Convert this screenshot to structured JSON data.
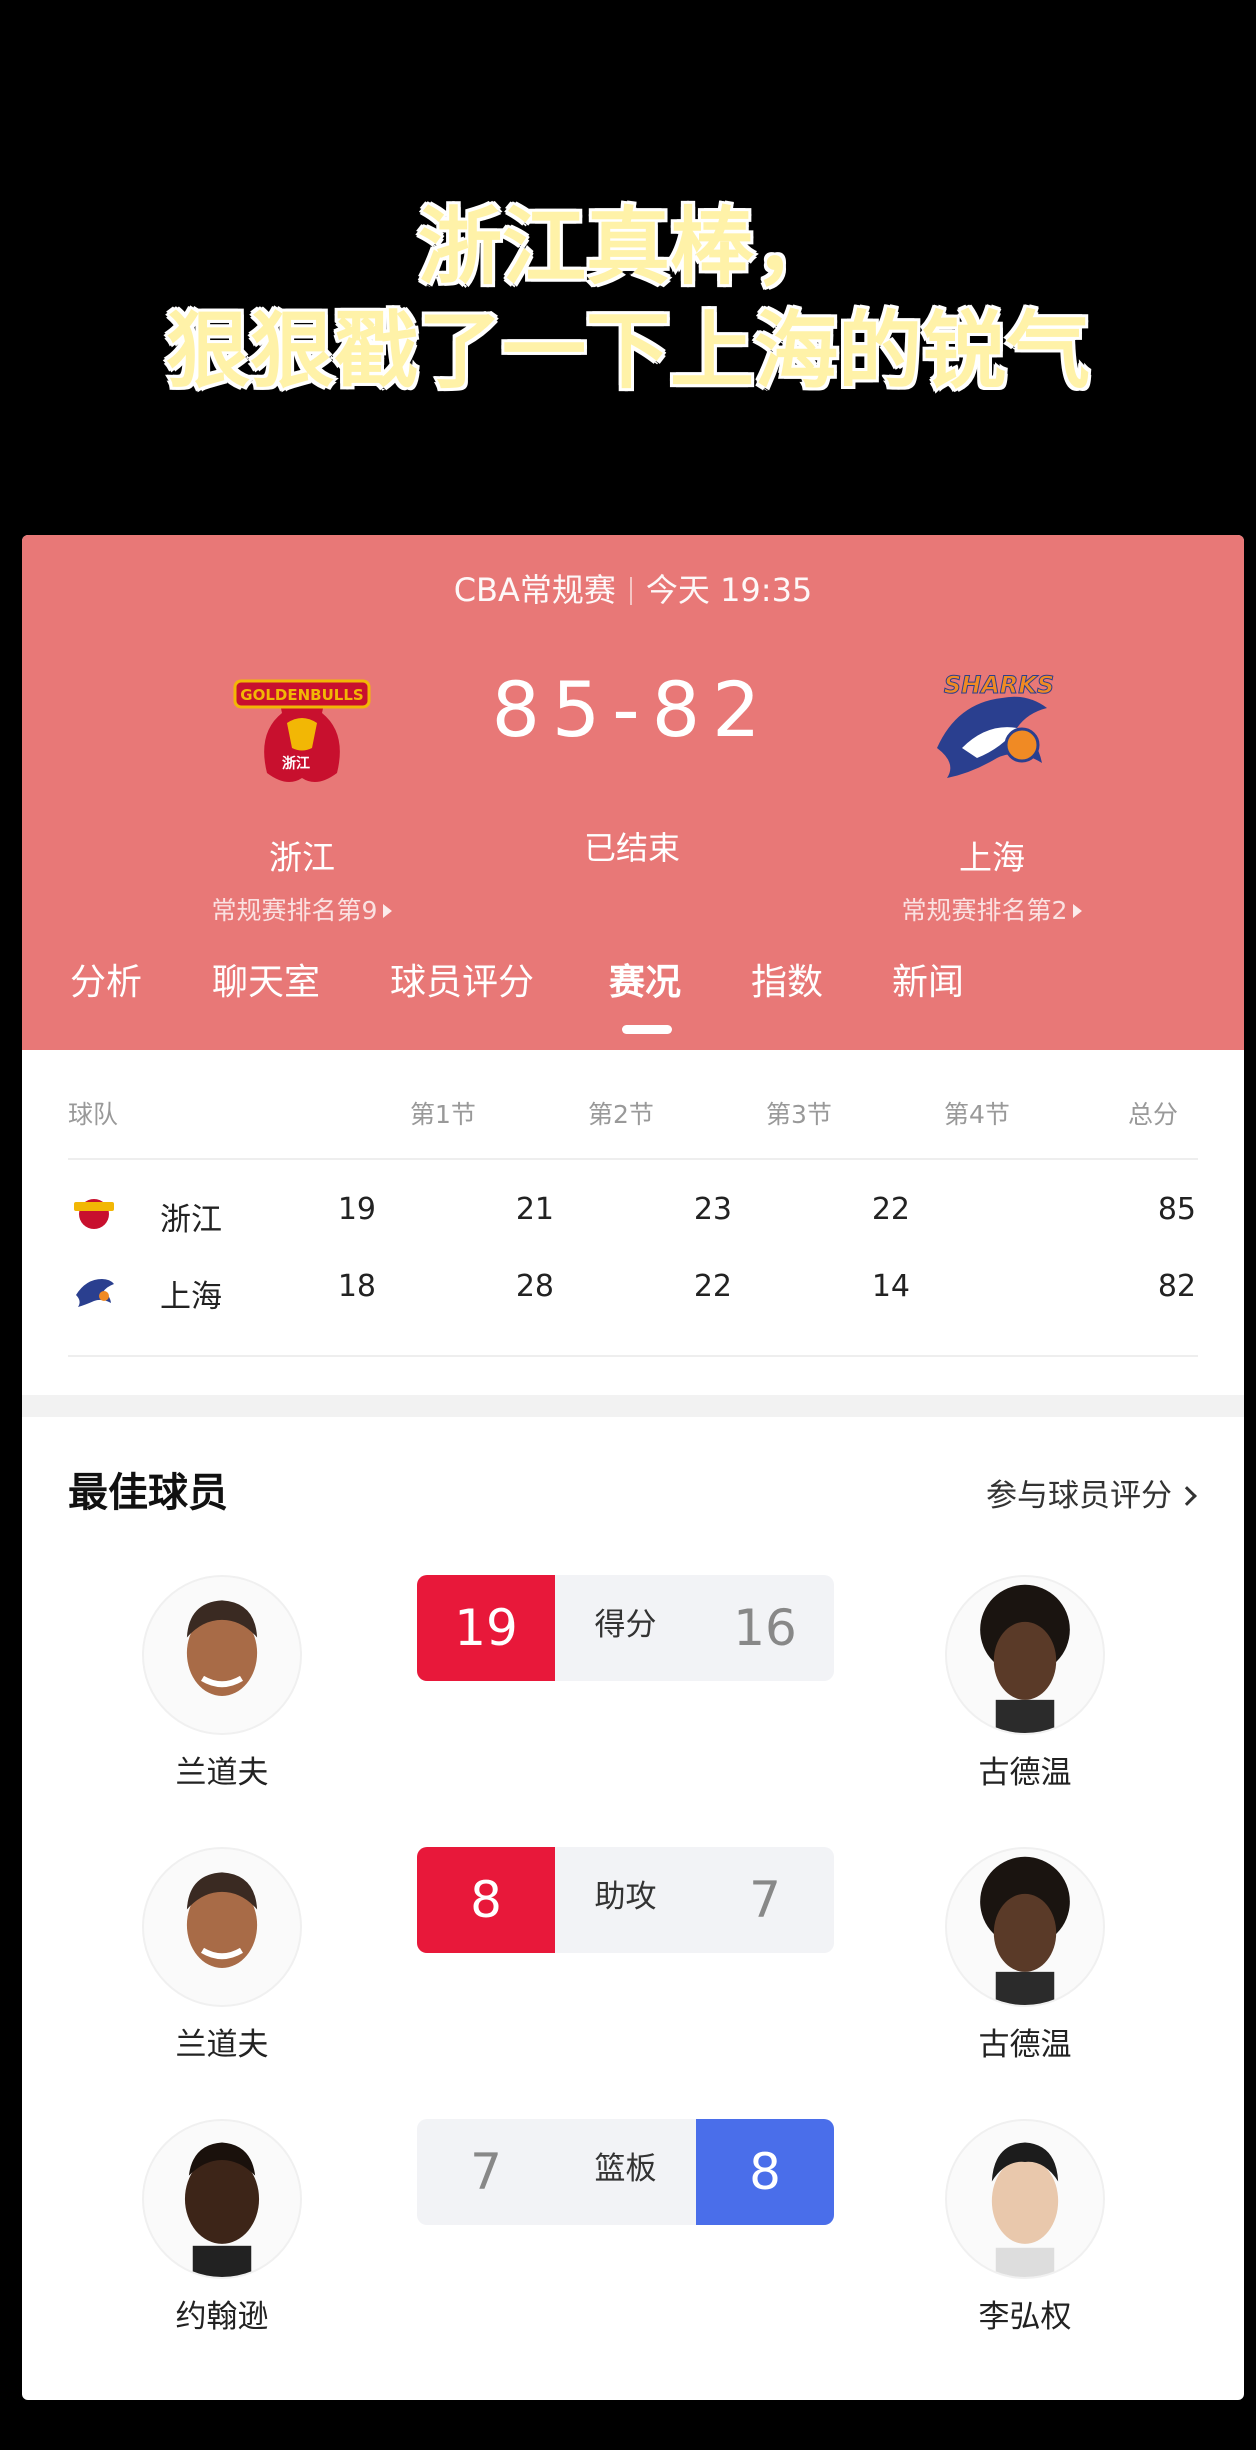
{
  "caption": {
    "line1": "浙江真棒，",
    "line2": "狠狠戳了一下上海的锐气"
  },
  "header": {
    "league": "CBA常规赛",
    "time": "今天 19:35"
  },
  "match": {
    "home": {
      "name": "浙江",
      "rank": "常规赛排名第9",
      "logo_icon": "golden-bulls-logo"
    },
    "away": {
      "name": "上海",
      "rank": "常规赛排名第2",
      "logo_icon": "sharks-logo"
    },
    "score": "85-82",
    "status": "已结束"
  },
  "tabs": [
    {
      "label": "分析",
      "active": false
    },
    {
      "label": "聊天室",
      "active": false
    },
    {
      "label": "球员评分",
      "active": false
    },
    {
      "label": "赛况",
      "active": true
    },
    {
      "label": "指数",
      "active": false
    },
    {
      "label": "新闻",
      "active": false
    }
  ],
  "quarters": {
    "headers": [
      "球队",
      "第1节",
      "第2节",
      "第3节",
      "第4节",
      "总分"
    ],
    "rows": [
      {
        "team": "浙江",
        "scores": [
          "19",
          "21",
          "23",
          "22",
          "85"
        ]
      },
      {
        "team": "上海",
        "scores": [
          "18",
          "28",
          "22",
          "14",
          "82"
        ]
      }
    ]
  },
  "best_players": {
    "title": "最佳球员",
    "link": "参与球员评分",
    "rows": [
      {
        "stat": "得分",
        "left_player": "兰道夫",
        "left_value": "19",
        "right_player": "古德温",
        "right_value": "16",
        "winner": "left"
      },
      {
        "stat": "助攻",
        "left_player": "兰道夫",
        "left_value": "8",
        "right_player": "古德温",
        "right_value": "7",
        "winner": "left"
      },
      {
        "stat": "篮板",
        "left_player": "约翰逊",
        "left_value": "7",
        "right_player": "李弘权",
        "right_value": "8",
        "winner": "right"
      }
    ]
  },
  "colors": {
    "hero_bg": "#E87877",
    "home_win": "#E8183A",
    "away_win": "#4A6EEA",
    "caption_fill": "#FFF2A8"
  }
}
